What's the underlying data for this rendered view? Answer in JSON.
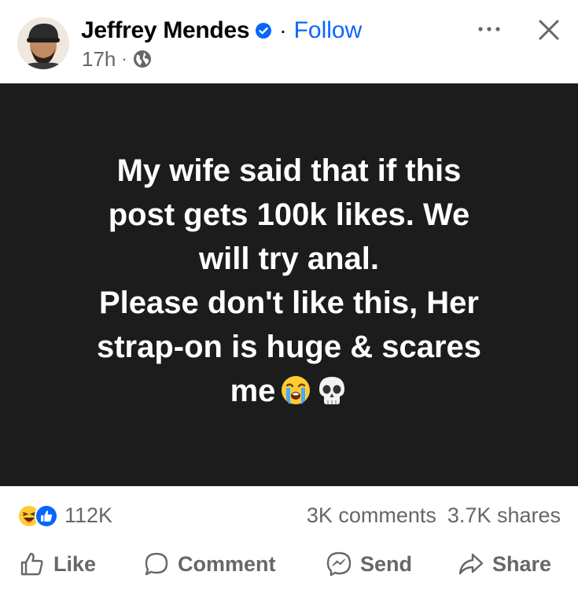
{
  "post": {
    "author": "Jeffrey Mendes",
    "separator": "·",
    "follow_label": "Follow",
    "time": "17h",
    "meta_separator": "·",
    "privacy_icon": "globe-icon",
    "text_lines": [
      "My wife said that if this",
      "post gets 100k likes. We",
      "will try anal.",
      "Please don't like this, Her",
      "strap-on is huge & scares",
      "me"
    ],
    "text_emojis": [
      "loudly-crying-face",
      "skull"
    ],
    "background": "#1c1c1c"
  },
  "stats": {
    "reaction_icons": [
      "haha-reaction-icon",
      "like-reaction-icon"
    ],
    "reaction_count": "112K",
    "comments": "3K comments",
    "shares": "3.7K shares"
  },
  "actions": {
    "like": "Like",
    "comment": "Comment",
    "send": "Send",
    "share": "Share"
  },
  "colors": {
    "accent": "#0866ff",
    "secondary_text": "#65676b"
  }
}
